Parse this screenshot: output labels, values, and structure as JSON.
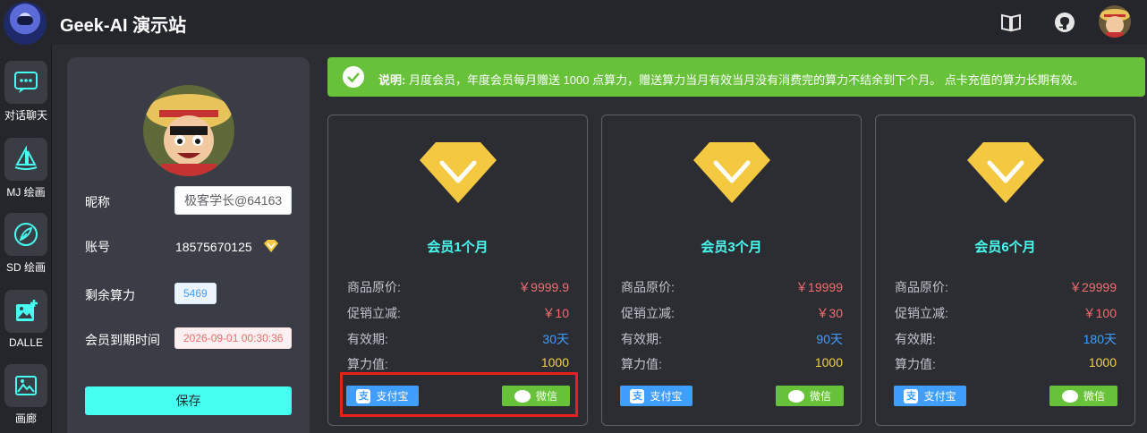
{
  "app": {
    "title": "Geek-AI 演示站"
  },
  "topbar_icons": [
    "book-icon",
    "github-icon",
    "user-avatar"
  ],
  "nav": [
    {
      "label": "对话聊天",
      "icon": "chat-icon"
    },
    {
      "label": "MJ 绘画",
      "icon": "sailboat-icon"
    },
    {
      "label": "SD 绘画",
      "icon": "feather-icon"
    },
    {
      "label": "DALLE",
      "icon": "image-plus-icon"
    },
    {
      "label": "画廊",
      "icon": "gallery-icon"
    }
  ],
  "profile": {
    "nickname_label": "昵称",
    "nickname_value": "极客学长@64163",
    "account_label": "账号",
    "account_value": "18575670125",
    "power_label": "剩余算力",
    "power_value": "5469",
    "expire_label": "会员到期时间",
    "expire_value": "2026-09-01 00:30:36",
    "save_label": "保存"
  },
  "notice": {
    "prefix": "说明:",
    "text": "月度会员，年度会员每月赠送 1000 点算力，赠送算力当月有效当月没有消费完的算力不结余到下个月。 点卡充值的算力长期有效。"
  },
  "labels": {
    "original_price": "商品原价:",
    "discount": "促销立减:",
    "validity": "有效期:",
    "power": "算力值:",
    "alipay": "支付宝",
    "wechat": "微信"
  },
  "products": [
    {
      "title": "会员1个月",
      "price": "￥9999.9",
      "discount": "￥10",
      "validity": "30天",
      "power": "1000"
    },
    {
      "title": "会员3个月",
      "price": "￥19999",
      "discount": "￥30",
      "validity": "90天",
      "power": "1000"
    },
    {
      "title": "会员6个月",
      "price": "￥29999",
      "discount": "￥100",
      "validity": "180天",
      "power": "1000"
    }
  ],
  "colors": {
    "accent": "#47fff1",
    "success": "#67c23a",
    "primary": "#409eff",
    "danger": "#f56c6c",
    "gold": "#f5c842"
  }
}
